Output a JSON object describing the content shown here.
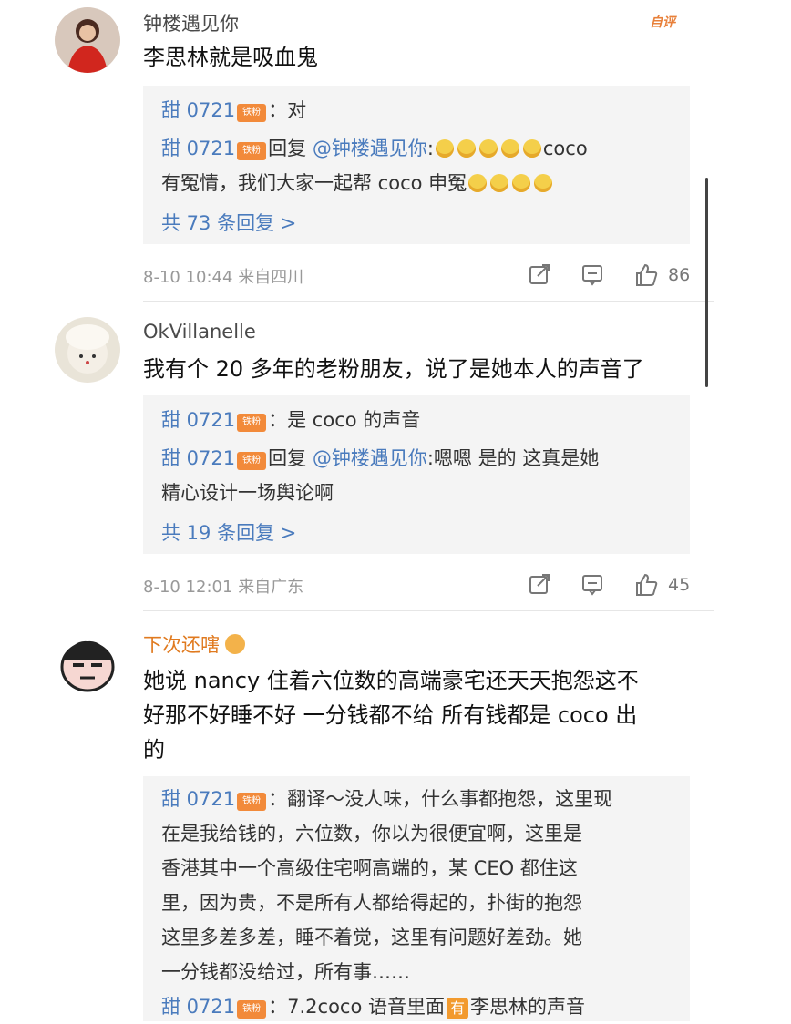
{
  "comments": [
    {
      "username": "钟楼遇见你",
      "author_tag": "自评",
      "content": "李思林就是吸血鬼",
      "replies": [
        {
          "name": "甜 0721",
          "badge": "铁粉",
          "text": "：对"
        },
        {
          "name": "甜 0721",
          "badge": "铁粉",
          "prefix": "回复 ",
          "mention": "@钟楼遇见你",
          "text_a": ":",
          "text_b": "coco",
          "text_c": "有冤情，我们大家一起帮 coco 申冤"
        }
      ],
      "more": "共 73 条回复 >",
      "time": "8-10 10:44",
      "location": "来自四川",
      "likes": "86"
    },
    {
      "username": "OkVillanelle",
      "content": "我有个 20 多年的老粉朋友，说了是她本人的声音了",
      "replies": [
        {
          "name": "甜 0721",
          "badge": "铁粉",
          "text": "：是 coco 的声音"
        },
        {
          "name": "甜 0721",
          "badge": "铁粉",
          "prefix": "回复 ",
          "mention": "@钟楼遇见你",
          "text_a": ":嗯嗯 是的 这真是她",
          "text_c": "精心设计一场舆论啊"
        }
      ],
      "more": "共 19 条回复 >",
      "time": "8-10 12:01",
      "location": "来自广东",
      "likes": "45"
    },
    {
      "username": "下次还嗐",
      "content_lines": [
        "她说 nancy 住着六位数的高端豪宅还天天抱怨这不",
        "好那不好睡不好 一分钱都不给 所有钱都是 coco 出",
        "的"
      ],
      "replies": [
        {
          "name": "甜 0721",
          "badge": "铁粉",
          "lines": [
            "：翻译～没人味，什么事都抱怨，这里现",
            "在是我给钱的，六位数，你以为很便宜啊，这里是",
            "香港其中一个高级住宅啊高端的，某 CEO 都住这",
            "里，因为贵，不是所有人都给得起的，扑街的抱怨",
            "这里多差多差，睡不着觉，这里有问题好差劲。她",
            "一分钱都没给过，所有事……"
          ]
        },
        {
          "name": "甜 0721",
          "badge": "铁粉",
          "text_a": "：7.2coco 语音里面",
          "youyou": "有",
          "text_b": "李思林的声音"
        }
      ]
    }
  ]
}
